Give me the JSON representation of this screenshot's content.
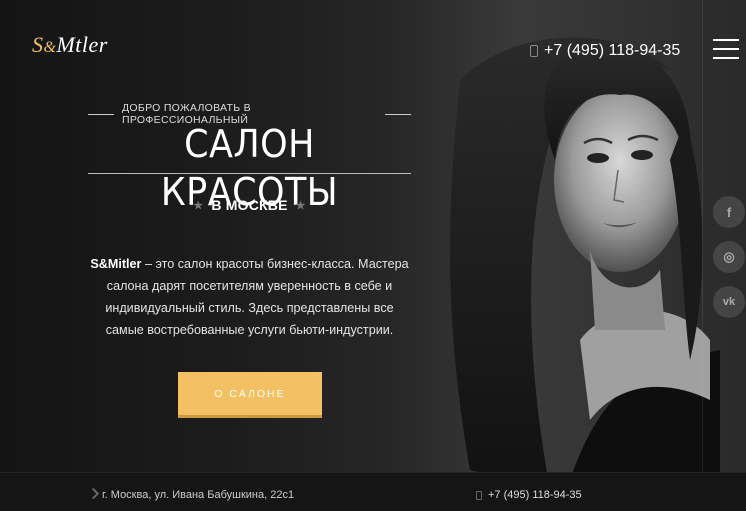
{
  "brand": {
    "logo_s": "S",
    "logo_amp": "&",
    "logo_rest": "Mtler"
  },
  "header": {
    "phone": "+7 (495) 118-94-35"
  },
  "hero": {
    "welcome": "ДОБРО ПОЖАЛОВАТЬ В ПРОФЕССИОНАЛЬНЫЙ",
    "title": "САЛОН КРАСОТЫ",
    "city": "В МОСКВЕ",
    "desc_brand": "S&Mitler",
    "desc_text": " – это салон красоты бизнес-класса. Мастера салона дарят посетителям уверенность в себе и индивидуальный стиль. Здесь представлены все самые востребованные услуги бьюти-индустрии.",
    "cta_label": "О САЛОНЕ"
  },
  "social": [
    {
      "name": "facebook",
      "glyph": "f"
    },
    {
      "name": "instagram",
      "glyph": "◎"
    },
    {
      "name": "vk",
      "glyph": "vk"
    }
  ],
  "footer": {
    "address": "г. Москва, ул. Ивана Бабушкина, 22с1",
    "phone": "+7 (495) 118-94-35"
  },
  "colors": {
    "accent": "#f3c163",
    "background": "#141414"
  }
}
